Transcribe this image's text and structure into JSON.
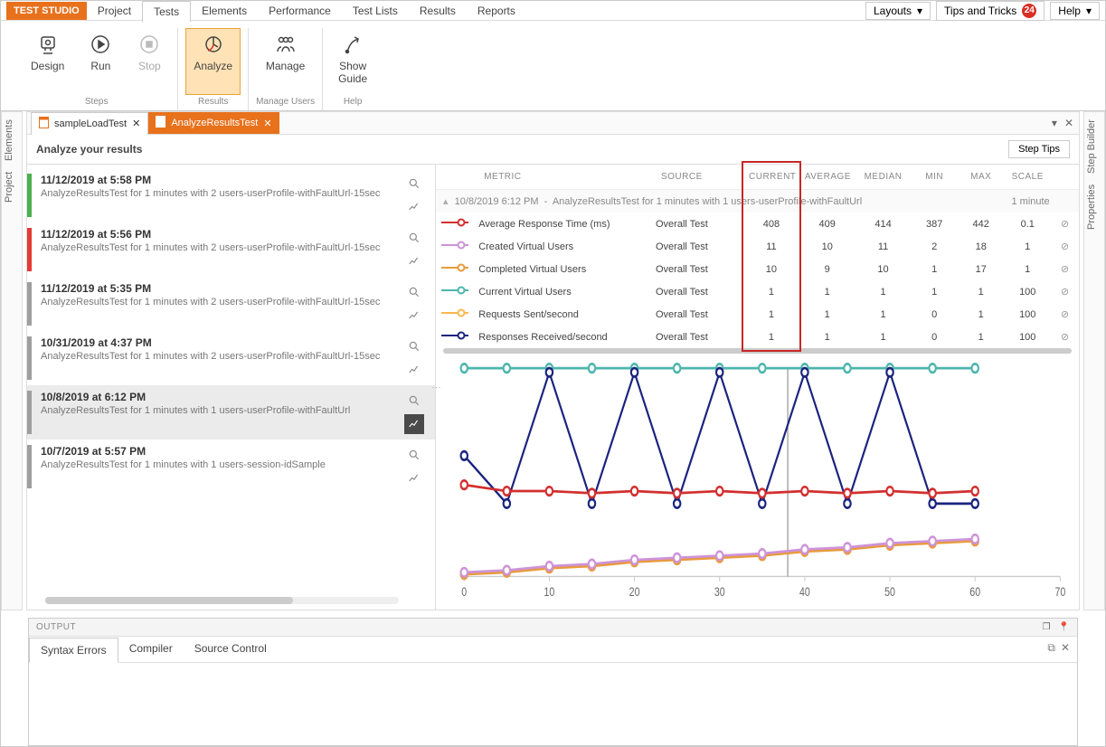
{
  "app": {
    "brand": "TEST STUDIO"
  },
  "menubar": {
    "items": [
      "Project",
      "Tests",
      "Elements",
      "Performance",
      "Test Lists",
      "Results",
      "Reports"
    ],
    "active": 1,
    "layouts": "Layouts",
    "tips": "Tips and Tricks",
    "tips_badge": "24",
    "help": "Help"
  },
  "ribbon": {
    "groups": [
      {
        "footer": "Steps",
        "items": [
          {
            "label": "Design",
            "icon": "design"
          },
          {
            "label": "Run",
            "icon": "run"
          },
          {
            "label": "Stop",
            "icon": "stop",
            "disabled": true
          }
        ]
      },
      {
        "footer": "Results",
        "items": [
          {
            "label": "Analyze",
            "icon": "analyze",
            "active": true
          }
        ]
      },
      {
        "footer": "Manage Users",
        "items": [
          {
            "label": "Manage",
            "icon": "manage"
          }
        ]
      },
      {
        "footer": "Help",
        "items": [
          {
            "label": "Show\nGuide",
            "icon": "guide"
          }
        ]
      }
    ]
  },
  "doctabs": {
    "tabs": [
      {
        "name": "sampleLoadTest",
        "active": false
      },
      {
        "name": "AnalyzeResultsTest",
        "active": true
      }
    ]
  },
  "analyze": {
    "title": "Analyze your results",
    "step_tips": "Step Tips"
  },
  "runs": [
    {
      "bar": "green",
      "time": "11/12/2019 at 5:58 PM",
      "desc": "AnalyzeResultsTest for 1 minutes with 2 users-userProfile-withFaultUrl-15sec"
    },
    {
      "bar": "red",
      "time": "11/12/2019 at 5:56 PM",
      "desc": "AnalyzeResultsTest for 1 minutes with 2 users-userProfile-withFaultUrl-15sec"
    },
    {
      "bar": "grey",
      "time": "11/12/2019 at 5:35 PM",
      "desc": "AnalyzeResultsTest for 1 minutes with 2 users-userProfile-withFaultUrl-15sec"
    },
    {
      "bar": "grey",
      "time": "10/31/2019 at 4:37 PM",
      "desc": "AnalyzeResultsTest for 1 minutes with 2 users-userProfile-withFaultUrl-15sec"
    },
    {
      "bar": "grey",
      "time": "10/8/2019 at 6:12 PM",
      "desc": "AnalyzeResultsTest for 1 minutes with 1 users-userProfile-withFaultUrl",
      "selected": true
    },
    {
      "bar": "grey",
      "time": "10/7/2019 at 5:57 PM",
      "desc": "AnalyzeResultsTest for 1 minutes with 1 users-session-idSample"
    }
  ],
  "metrics": {
    "headers": [
      "METRIC",
      "SOURCE",
      "CURRENT",
      "AVERAGE",
      "MEDIAN",
      "MIN",
      "MAX",
      "SCALE"
    ],
    "group_time": "10/8/2019 6:12 PM",
    "group_desc": "AnalyzeResultsTest for 1 minutes with 1 users-userProfile-withFaultUrl",
    "group_duration": "1 minute",
    "rows": [
      {
        "color": "#d32f2f",
        "fill": false,
        "name": "Average Response Time (ms)",
        "source": "Overall Test",
        "current": "408",
        "average": "409",
        "median": "414",
        "min": "387",
        "max": "442",
        "scale": "0.1"
      },
      {
        "color": "#ce93d8",
        "fill": false,
        "name": "Created Virtual Users",
        "source": "Overall Test",
        "current": "11",
        "average": "10",
        "median": "11",
        "min": "2",
        "max": "18",
        "scale": "1"
      },
      {
        "color": "#e89b3c",
        "fill": false,
        "name": "Completed Virtual Users",
        "source": "Overall Test",
        "current": "10",
        "average": "9",
        "median": "10",
        "min": "1",
        "max": "17",
        "scale": "1"
      },
      {
        "color": "#4db6ac",
        "fill": false,
        "name": "Current Virtual Users",
        "source": "Overall Test",
        "current": "1",
        "average": "1",
        "median": "1",
        "min": "1",
        "max": "1",
        "scale": "100"
      },
      {
        "color": "#ffb74d",
        "fill": false,
        "name": "Requests Sent/second",
        "source": "Overall Test",
        "current": "1",
        "average": "1",
        "median": "1",
        "min": "0",
        "max": "1",
        "scale": "100"
      },
      {
        "color": "#1a237e",
        "fill": false,
        "name": "Responses Received/second",
        "source": "Overall Test",
        "current": "1",
        "average": "1",
        "median": "1",
        "min": "0",
        "max": "1",
        "scale": "100"
      }
    ]
  },
  "chart_data": {
    "type": "line",
    "x": [
      0,
      5,
      10,
      15,
      20,
      25,
      30,
      35,
      40,
      45,
      50,
      55,
      60
    ],
    "xlim": [
      0,
      70
    ],
    "xticks": [
      0,
      10,
      20,
      30,
      40,
      50,
      60,
      70
    ],
    "ylim": [
      0,
      100
    ],
    "vline_at": 38,
    "series": [
      {
        "name": "Current Virtual Users (×100)",
        "color": "#4db6ac",
        "values": [
          100,
          100,
          100,
          100,
          100,
          100,
          100,
          100,
          100,
          100,
          100,
          100,
          100
        ]
      },
      {
        "name": "Responses Received/second (×100)",
        "color": "#1a237e",
        "values": [
          58,
          35,
          98,
          35,
          98,
          35,
          98,
          35,
          98,
          35,
          98,
          35,
          35
        ]
      },
      {
        "name": "Average Response Time (ms) (×0.1)",
        "color": "#d32f2f",
        "values": [
          44,
          41,
          41,
          40,
          41,
          40,
          41,
          40,
          41,
          40,
          41,
          40,
          41
        ]
      },
      {
        "name": "Completed Virtual Users",
        "color": "#e89b3c",
        "values": [
          1,
          2,
          4,
          5,
          7,
          8,
          9,
          10,
          12,
          13,
          15,
          16,
          17
        ]
      },
      {
        "name": "Created Virtual Users",
        "color": "#ce93d8",
        "values": [
          2,
          3,
          5,
          6,
          8,
          9,
          10,
          11,
          13,
          14,
          16,
          17,
          18
        ]
      }
    ]
  },
  "output": {
    "header": "OUTPUT",
    "tabs": [
      "Syntax Errors",
      "Compiler",
      "Source Control"
    ]
  },
  "rails": {
    "left": [
      "Project",
      "Elements"
    ],
    "right": [
      "Properties",
      "Step Builder"
    ]
  }
}
